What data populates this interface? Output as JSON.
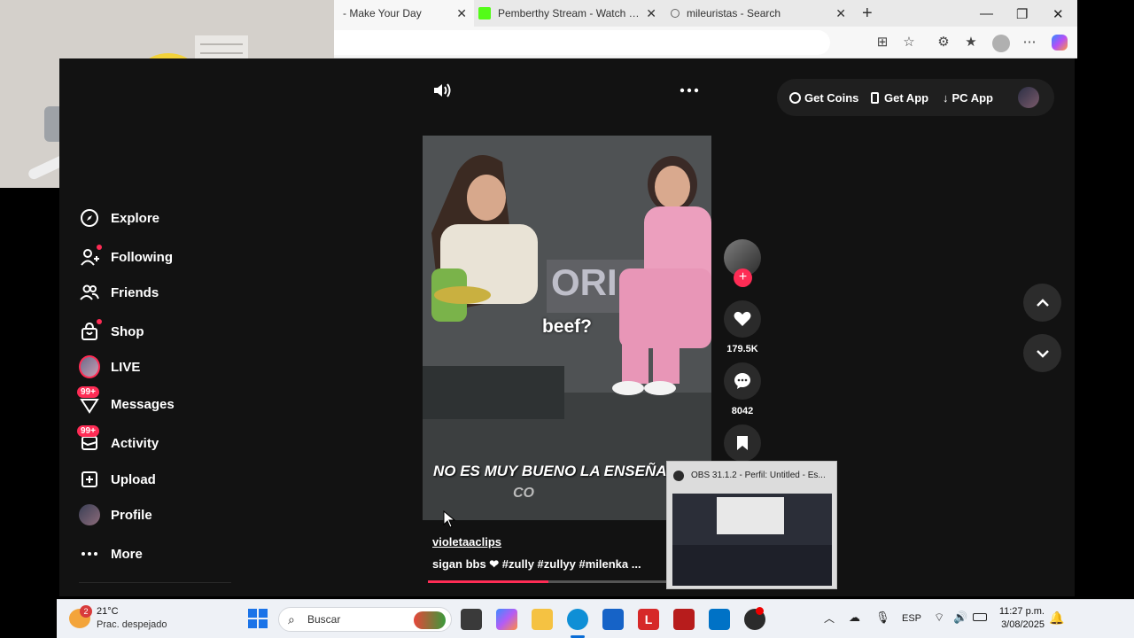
{
  "browser": {
    "tabs": [
      {
        "title": "- Make Your Day",
        "active": true
      },
      {
        "title": "Pemberthy Stream - Watch Live o",
        "active": false
      },
      {
        "title": "mileuristas - Search",
        "active": false
      }
    ],
    "new_tab": "+",
    "close": "✕"
  },
  "sidebar": {
    "items": [
      {
        "label": "Explore",
        "icon": "compass-icon"
      },
      {
        "label": "Following",
        "icon": "following-icon"
      },
      {
        "label": "Friends",
        "icon": "friends-icon"
      },
      {
        "label": "Shop",
        "icon": "shop-icon"
      },
      {
        "label": "LIVE",
        "icon": "live-icon"
      },
      {
        "label": "Messages",
        "icon": "messages-icon",
        "badge": "99+"
      },
      {
        "label": "Activity",
        "icon": "activity-icon",
        "badge": "99+"
      },
      {
        "label": "Upload",
        "icon": "upload-icon"
      },
      {
        "label": "Profile",
        "icon": "profile-icon"
      },
      {
        "label": "More",
        "icon": "more-icon"
      }
    ]
  },
  "topbar": {
    "get_coins": "Get Coins",
    "get_app": "Get App",
    "pc_app": "PC App"
  },
  "video": {
    "caption_center": "beef?",
    "caption_bottom": "NO ES MUY BUENO LA ENSEÑA",
    "caption_partial": "CO",
    "author": "violetaaclips",
    "description": "sigan bbs ❤ #zully  #zullyy  #milenka  ..."
  },
  "actions": {
    "likes": "179.5K",
    "comments": "8042"
  },
  "obs": {
    "title": "OBS 31.1.2 - Perfil: Untitled - Es..."
  },
  "taskbar": {
    "weather_temp": "21°C",
    "weather_desc": "Prac. despejado",
    "weather_badge": "2",
    "search_placeholder": "Buscar",
    "lang": "ESP",
    "time": "11:27 p.m.",
    "date": "3/08/2025"
  },
  "colors": {
    "accent": "#fe2c55",
    "background": "#121212"
  }
}
